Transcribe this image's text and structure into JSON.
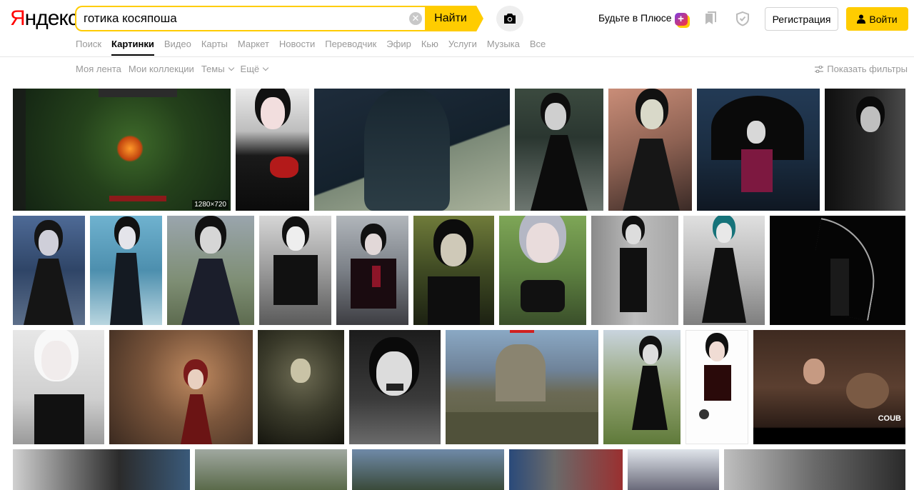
{
  "header": {
    "logo": {
      "first": "Я",
      "rest": "ндекс"
    },
    "search": {
      "value": "готика косяпоша",
      "placeholder": ""
    },
    "search_button": "Найти",
    "plus_link": "Будьте в Плюсе",
    "plus_badge": "+",
    "register": "Регистрация",
    "login": "Войти"
  },
  "nav": {
    "items": [
      {
        "label": "Поиск",
        "active": false
      },
      {
        "label": "Картинки",
        "active": true
      },
      {
        "label": "Видео",
        "active": false
      },
      {
        "label": "Карты",
        "active": false
      },
      {
        "label": "Маркет",
        "active": false
      },
      {
        "label": "Новости",
        "active": false
      },
      {
        "label": "Переводчик",
        "active": false
      },
      {
        "label": "Эфир",
        "active": false
      },
      {
        "label": "Кью",
        "active": false
      },
      {
        "label": "Услуги",
        "active": false
      },
      {
        "label": "Музыка",
        "active": false
      },
      {
        "label": "Все",
        "active": false
      }
    ]
  },
  "subnav": {
    "feed": "Моя лента",
    "collections": "Мои коллекции",
    "topics": "Темы",
    "more": "Ещё",
    "filters": "Показать фильтры"
  },
  "images": {
    "first_size": "1280×720",
    "coub_label": "COUB"
  },
  "colors": {
    "accent": "#ffcc00",
    "brand_red": "#ff0000",
    "muted_text": "#999999"
  }
}
